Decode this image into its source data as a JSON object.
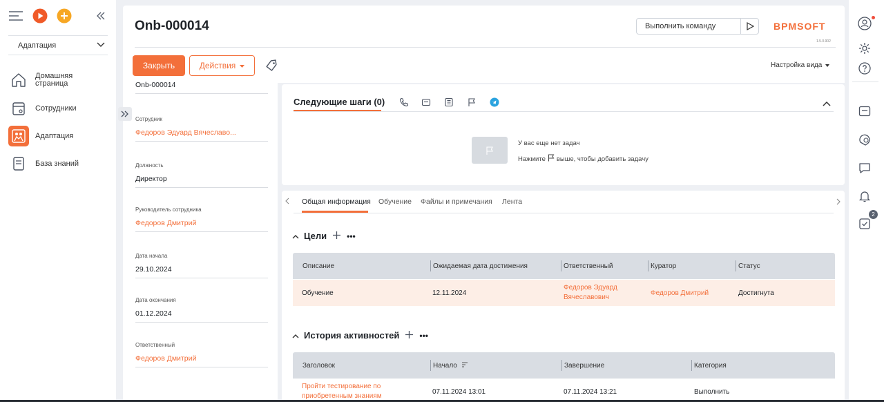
{
  "sidebar": {
    "workspace": "Адаптация",
    "items": [
      {
        "label_line1": "Домашняя",
        "label_line2": "страница",
        "icon": "home-icon"
      },
      {
        "label": "Сотрудники",
        "icon": "employees-icon"
      },
      {
        "label": "Адаптация",
        "icon": "onboarding-icon",
        "active": true
      },
      {
        "label": "База знаний",
        "icon": "knowledge-base-icon"
      }
    ]
  },
  "header": {
    "record_title": "Onb-000014",
    "command_placeholder": "Выполнить команду",
    "logo_text": "BPMSOFT",
    "version": "1.5.0.902",
    "close_label": "Закрыть",
    "actions_label": "Действия",
    "view_settings_label": "Настройка вида"
  },
  "fields": [
    {
      "label": "",
      "value": "Onb-000014",
      "link": false
    },
    {
      "label": "Сотрудник",
      "value": "Федоров Эдуард Вячеславо...",
      "link": true
    },
    {
      "label": "Должность",
      "value": "Директор",
      "link": false
    },
    {
      "label": "Руководитель сотрудника",
      "value": "Федоров Дмитрий",
      "link": true
    },
    {
      "label": "Дата начала",
      "value": "29.10.2024",
      "link": false
    },
    {
      "label": "Дата окончания",
      "value": "01.12.2024",
      "link": false
    },
    {
      "label": "Ответственный",
      "value": "Федоров Дмитрий",
      "link": true
    }
  ],
  "next_steps": {
    "title": "Следующие шаги (0)",
    "empty_line1": "У вас еще нет задач",
    "empty_line2_before": "Нажмите",
    "empty_line2_after": "выше, чтобы добавить задачу"
  },
  "tabs": [
    "Общая информация",
    "Обучение",
    "Файлы и примечания",
    "Лента"
  ],
  "goals": {
    "title": "Цели",
    "columns": [
      "Описание",
      "Ожидаемая дата достижения",
      "Ответственный",
      "Куратор",
      "Статус"
    ],
    "rows": [
      {
        "description": "Обучение",
        "date": "12.11.2024",
        "responsible_line1": "Федоров Эдуард",
        "responsible_line2": "Вячеславович",
        "curator": "Федоров Дмитрий",
        "status": "Достигнута"
      }
    ]
  },
  "activities": {
    "title": "История активностей",
    "columns": [
      "Заголовок",
      "Начало",
      "Завершение",
      "Категория"
    ],
    "rows": [
      {
        "title_line1": "Пройти тестирование по",
        "title_line2": "приобретенным знаниям",
        "start": "07.11.2024 13:01",
        "end": "07.11.2024 13:21",
        "category": "Выполнить"
      }
    ]
  },
  "rightbar": {
    "tasks_badge": "2"
  },
  "colors": {
    "accent": "#f36f3a",
    "goal_row_bg": "#fdeee6",
    "grid_header_bg": "#d9dde3"
  }
}
